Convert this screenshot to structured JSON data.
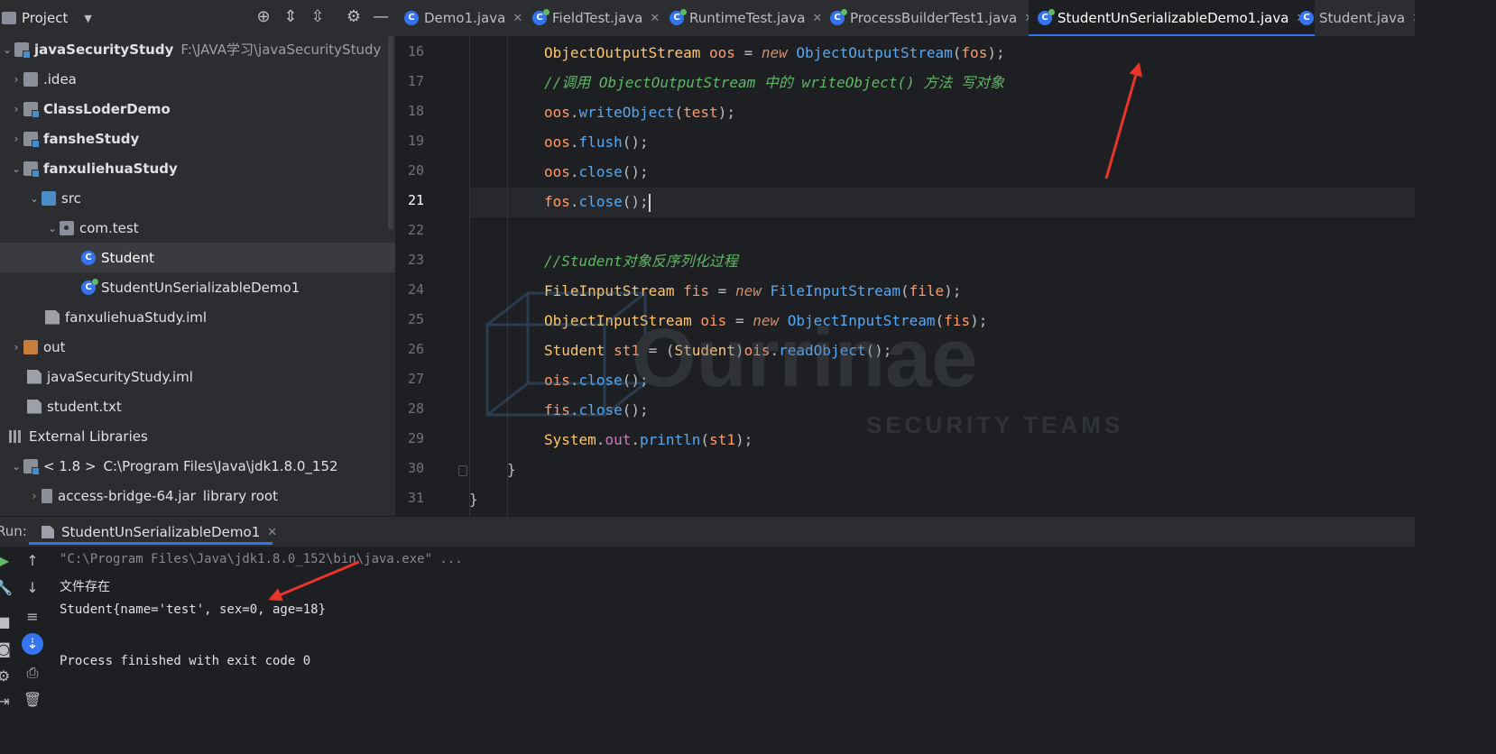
{
  "project_panel": {
    "title": "Project",
    "tree": [
      {
        "label": "javaSecurityStudy",
        "path": "F:\\JAVA学习\\javaSecurityStudy"
      },
      {
        "label": ".idea"
      },
      {
        "label": "ClassLoderDemo"
      },
      {
        "label": "fansheStudy"
      },
      {
        "label": "fanxuliehuaStudy"
      },
      {
        "label": "src"
      },
      {
        "label": "com.test"
      },
      {
        "label": "Student"
      },
      {
        "label": "StudentUnSerializableDemo1"
      },
      {
        "label": "fanxuliehuaStudy.iml"
      },
      {
        "label": "out"
      },
      {
        "label": "javaSecurityStudy.iml"
      },
      {
        "label": "student.txt"
      },
      {
        "label": "External Libraries"
      },
      {
        "label": "< 1.8 >",
        "path": "C:\\Program Files\\Java\\jdk1.8.0_152"
      },
      {
        "label": "access-bridge-64.jar",
        "path": "library root"
      }
    ]
  },
  "tabs": [
    {
      "label": "Demo1.java"
    },
    {
      "label": "FieldTest.java"
    },
    {
      "label": "RuntimeTest.java"
    },
    {
      "label": "ProcessBuilderTest1.java"
    },
    {
      "label": "StudentUnSerializableDemo1.java"
    },
    {
      "label": "Student.java"
    }
  ],
  "editor": {
    "line_numbers": [
      "16",
      "17",
      "18",
      "19",
      "20",
      "21",
      "22",
      "23",
      "24",
      "25",
      "26",
      "27",
      "28",
      "29",
      "30",
      "31"
    ],
    "current_line": "21"
  },
  "run": {
    "label": "Run:",
    "tab": "StudentUnSerializableDemo1",
    "output": [
      "\"C:\\Program Files\\Java\\jdk1.8.0_152\\bin\\java.exe\" ...",
      "文件存在",
      "Student{name='test', sex=0, age=18}",
      "",
      "Process finished with exit code 0"
    ]
  },
  "watermark": {
    "brand": "Ourrinae",
    "sub": "SECURITY TEAMS"
  },
  "colors": {
    "accent": "#3574f0",
    "annotation_arrow": "#e8352b",
    "comment": "#5fb865",
    "keyword": "#cf8e6d",
    "method": "#56a8f5",
    "type": "#ffc66d"
  }
}
